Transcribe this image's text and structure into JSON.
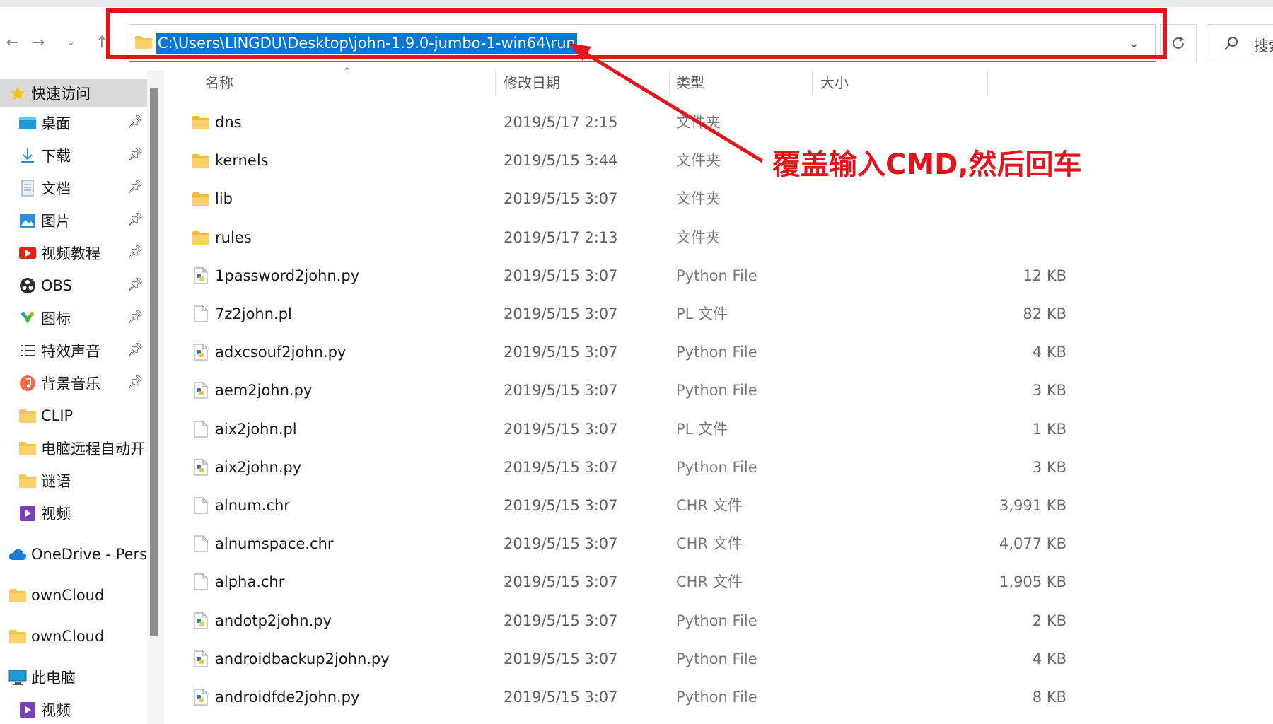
{
  "nav": {
    "address": "C:\\Users\\LINGDU\\Desktop\\john-1.9.0-jumbo-1-win64\\run",
    "search_label": "搜索"
  },
  "sidebar": {
    "items": [
      {
        "label": "快速访问",
        "icon": "star-icon",
        "pinned": false
      },
      {
        "label": "桌面",
        "icon": "desktop-icon",
        "pinned": true
      },
      {
        "label": "下载",
        "icon": "download-icon",
        "pinned": true
      },
      {
        "label": "文档",
        "icon": "document-icon",
        "pinned": true
      },
      {
        "label": "图片",
        "icon": "pictures-icon",
        "pinned": true
      },
      {
        "label": "视频教程",
        "icon": "video-red-icon",
        "pinned": true
      },
      {
        "label": "OBS",
        "icon": "obs-icon",
        "pinned": true
      },
      {
        "label": "图标",
        "icon": "icon-folder-icon",
        "pinned": true
      },
      {
        "label": "特效声音",
        "icon": "list-icon",
        "pinned": true
      },
      {
        "label": "背景音乐",
        "icon": "music-icon",
        "pinned": true
      },
      {
        "label": "CLIP",
        "icon": "folder-icon",
        "pinned": false
      },
      {
        "label": "电脑远程自动开",
        "icon": "folder-icon",
        "pinned": false
      },
      {
        "label": "谜语",
        "icon": "folder-icon",
        "pinned": false
      },
      {
        "label": "视频",
        "icon": "video-icon",
        "pinned": false
      },
      {
        "label": "OneDrive - Perso",
        "icon": "cloud-icon",
        "pinned": false
      },
      {
        "label": "ownCloud",
        "icon": "folder-icon",
        "pinned": false
      },
      {
        "label": "ownCloud",
        "icon": "folder-icon",
        "pinned": false
      },
      {
        "label": "此电脑",
        "icon": "computer-icon",
        "pinned": false
      },
      {
        "label": "视频",
        "icon": "video-icon",
        "pinned": false
      }
    ]
  },
  "columns": {
    "name": "名称",
    "date": "修改日期",
    "type": "类型",
    "size": "大小"
  },
  "files": [
    {
      "name": "dns",
      "date": "2019/5/17 2:15",
      "type": "文件夹",
      "size": "",
      "kind": "folder"
    },
    {
      "name": "kernels",
      "date": "2019/5/15 3:44",
      "type": "文件夹",
      "size": "",
      "kind": "folder"
    },
    {
      "name": "lib",
      "date": "2019/5/15 3:07",
      "type": "文件夹",
      "size": "",
      "kind": "folder"
    },
    {
      "name": "rules",
      "date": "2019/5/17 2:13",
      "type": "文件夹",
      "size": "",
      "kind": "folder"
    },
    {
      "name": "1password2john.py",
      "date": "2019/5/15 3:07",
      "type": "Python File",
      "size": "12 KB",
      "kind": "python"
    },
    {
      "name": "7z2john.pl",
      "date": "2019/5/15 3:07",
      "type": "PL 文件",
      "size": "82 KB",
      "kind": "file"
    },
    {
      "name": "adxcsouf2john.py",
      "date": "2019/5/15 3:07",
      "type": "Python File",
      "size": "4 KB",
      "kind": "python"
    },
    {
      "name": "aem2john.py",
      "date": "2019/5/15 3:07",
      "type": "Python File",
      "size": "3 KB",
      "kind": "python"
    },
    {
      "name": "aix2john.pl",
      "date": "2019/5/15 3:07",
      "type": "PL 文件",
      "size": "1 KB",
      "kind": "file"
    },
    {
      "name": "aix2john.py",
      "date": "2019/5/15 3:07",
      "type": "Python File",
      "size": "3 KB",
      "kind": "python"
    },
    {
      "name": "alnum.chr",
      "date": "2019/5/15 3:07",
      "type": "CHR 文件",
      "size": "3,991 KB",
      "kind": "file"
    },
    {
      "name": "alnumspace.chr",
      "date": "2019/5/15 3:07",
      "type": "CHR 文件",
      "size": "4,077 KB",
      "kind": "file"
    },
    {
      "name": "alpha.chr",
      "date": "2019/5/15 3:07",
      "type": "CHR 文件",
      "size": "1,905 KB",
      "kind": "file"
    },
    {
      "name": "andotp2john.py",
      "date": "2019/5/15 3:07",
      "type": "Python File",
      "size": "2 KB",
      "kind": "python"
    },
    {
      "name": "androidbackup2john.py",
      "date": "2019/5/15 3:07",
      "type": "Python File",
      "size": "4 KB",
      "kind": "python"
    },
    {
      "name": "androidfde2john.py",
      "date": "2019/5/15 3:07",
      "type": "Python File",
      "size": "8 KB",
      "kind": "python"
    }
  ],
  "annotation": {
    "text": "覆盖输入CMD,然后回车",
    "color": "#e4141c"
  },
  "colors": {
    "selection": "#0078d7",
    "folder": "#f4c64b",
    "highlight": "#e4141c"
  }
}
